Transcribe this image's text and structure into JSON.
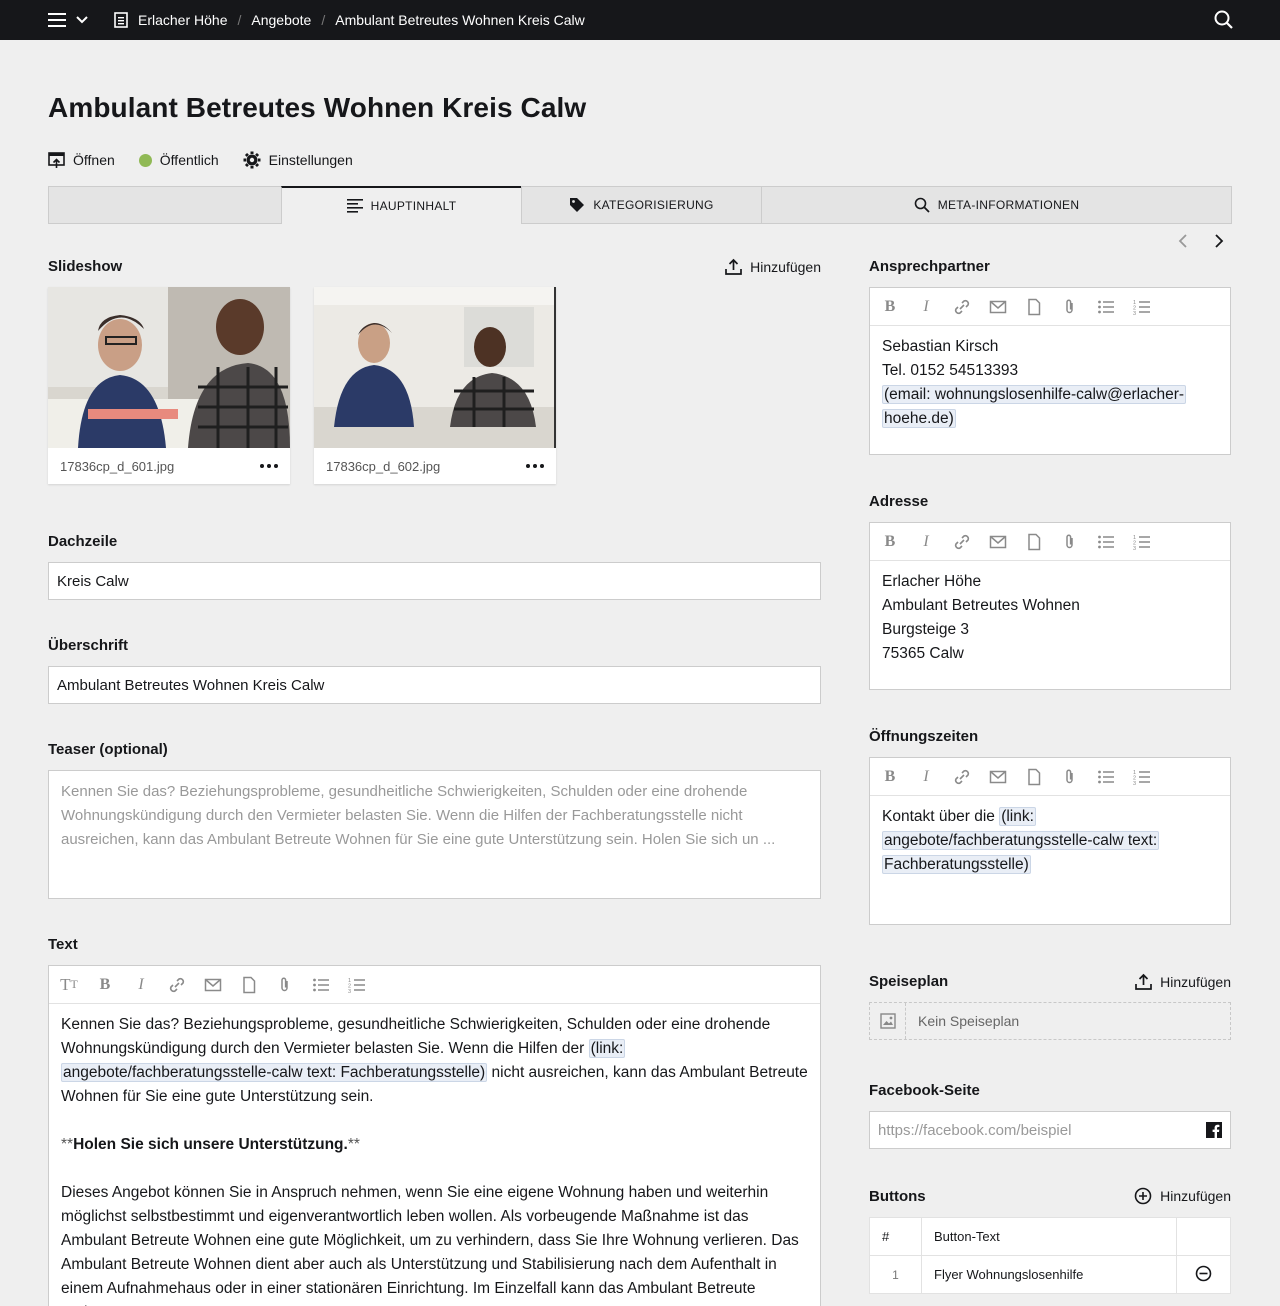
{
  "topbar": {
    "breadcrumb": [
      "Erlacher Höhe",
      "Angebote",
      "Ambulant Betreutes Wohnen Kreis Calw"
    ]
  },
  "page": {
    "title": "Ambulant Betreutes Wohnen Kreis Calw",
    "actions": {
      "open": "Öffnen",
      "status": "Öffentlich",
      "settings": "Einstellungen"
    },
    "status_color": "#90b955"
  },
  "tabs": [
    {
      "label": "HAUPTINHALT",
      "icon": "align-left-icon"
    },
    {
      "label": "KATEGORISIERUNG",
      "icon": "tag-icon"
    },
    {
      "label": "META-INFORMATIONEN",
      "icon": "search-icon"
    }
  ],
  "slideshow": {
    "label": "Slideshow",
    "add_label": "Hinzufügen",
    "images": [
      {
        "filename": "17836cp_d_601.jpg"
      },
      {
        "filename": "17836cp_d_602.jpg"
      }
    ]
  },
  "dachzeile": {
    "label": "Dachzeile",
    "value": "Kreis Calw"
  },
  "ueberschrift": {
    "label": "Überschrift",
    "value": "Ambulant Betreutes Wohnen Kreis Calw"
  },
  "teaser": {
    "label": "Teaser (optional)",
    "placeholder": "Kennen Sie das? Beziehungsprobleme, gesundheitliche Schwierigkeiten, Schulden oder eine drohende Wohnungskündigung durch den Vermieter belasten Sie. Wenn die Hilfen der Fachberatungsstelle nicht ausreichen, kann das Ambulant Betreute Wohnen für Sie eine gute Unterstützung sein. Holen Sie sich un ..."
  },
  "text": {
    "label": "Text",
    "p1_a": "Kennen Sie das? Beziehungsprobleme, gesundheitliche Schwierigkeiten, Schulden oder eine drohende Wohnungskündigung durch den Vermieter belasten Sie. Wenn die Hilfen der ",
    "p1_link_a": "(link:",
    "p1_link_b": "angebote/fachberatungsstelle-calw text: Fachberatungsstelle)",
    "p1_b": " nicht ausreichen, kann das Ambulant Betreute Wohnen für Sie eine gute Unterstützung sein.",
    "p2_mark_open": "**",
    "p2_bold": "Holen Sie sich unsere Unterstützung.",
    "p2_mark_close": "**",
    "p3": "Dieses Angebot können Sie in Anspruch nehmen, wenn Sie eine eigene Wohnung haben und weiterhin möglichst selbstbestimmt und eigenverantwortlich leben wollen. Als vorbeugende Maßnahme ist das Ambulant Betreute Wohnen eine gute Möglichkeit, um zu verhindern, dass Sie Ihre Wohnung verlieren. Das Ambulant Betreute Wohnen dient aber auch als Unterstützung und Stabilisierung nach dem Aufenthalt in einem Aufnahmehaus oder in einer stationären Einrichtung. Im Einzelfall kann das Ambulant Betreute Wohnen"
  },
  "ansprechpartner": {
    "label": "Ansprechpartner",
    "line1": "Sebastian Kirsch",
    "line2": "Tel. 0152 54513393",
    "email_a": "(email: wohnungslosenhilfe-calw@erlacher-",
    "email_b": "hoehe.de)"
  },
  "adresse": {
    "label": "Adresse",
    "lines": [
      "Erlacher Höhe",
      "Ambulant Betreutes Wohnen",
      "Burgsteige 3",
      "75365 Calw"
    ]
  },
  "oeffnungszeiten": {
    "label": "Öffnungszeiten",
    "prefix": "Kontakt über die ",
    "link_a": "(link:",
    "link_b": "angebote/fachberatungsstelle-calw text:",
    "link_c": "Fachberatungsstelle)"
  },
  "speiseplan": {
    "label": "Speiseplan",
    "add_label": "Hinzufügen",
    "empty": "Kein Speiseplan"
  },
  "facebook": {
    "label": "Facebook-Seite",
    "placeholder": "https://facebook.com/beispiel"
  },
  "buttons": {
    "label": "Buttons",
    "add_label": "Hinzufügen",
    "columns": [
      "#",
      "Button-Text"
    ],
    "rows": [
      {
        "index": "1",
        "text": "Flyer Wohnungslosenhilfe"
      }
    ]
  }
}
